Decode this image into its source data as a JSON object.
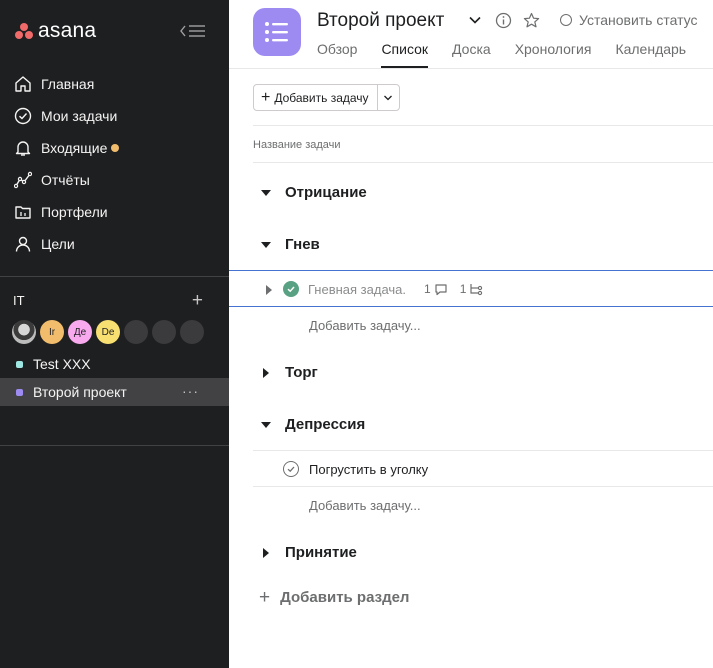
{
  "sidebar": {
    "logo_text": "asana",
    "nav": [
      {
        "label": "Главная",
        "icon": "home-icon"
      },
      {
        "label": "Мои задачи",
        "icon": "check-circle-icon"
      },
      {
        "label": "Входящие",
        "icon": "bell-icon"
      },
      {
        "label": "Отчёты",
        "icon": "reports-icon"
      },
      {
        "label": "Портфели",
        "icon": "folder-icon"
      },
      {
        "label": "Цели",
        "icon": "person-icon"
      }
    ],
    "team": {
      "name": "IT",
      "avatars": [
        {
          "initials": "",
          "color": "#3b3b3b"
        },
        {
          "initials": "Ir",
          "color": "#f1bd6c"
        },
        {
          "initials": "Де",
          "color": "#f9aaef"
        },
        {
          "initials": "De",
          "color": "#f8df72"
        },
        {
          "initials": "",
          "color": "#3b3b3d"
        },
        {
          "initials": "",
          "color": "#3b3b3d"
        },
        {
          "initials": "",
          "color": "#3b3b3d"
        }
      ]
    },
    "projects": [
      {
        "label": "Test XXX",
        "color": "#9ee7e3"
      },
      {
        "label": "Второй проект",
        "color": "#9d8bf2",
        "more": "···"
      }
    ]
  },
  "header": {
    "title": "Второй проект",
    "status_label": "Установить статус",
    "tabs": [
      "Обзор",
      "Список",
      "Доска",
      "Хронология",
      "Календарь"
    ],
    "active_tab": "Список"
  },
  "toolbar": {
    "add_task_label": "Добавить задачу"
  },
  "list": {
    "column_header": "Название задачи",
    "sections": [
      {
        "name": "Отрицание",
        "expanded": true
      },
      {
        "name": "Гнев",
        "expanded": true
      },
      {
        "name": "Торг",
        "expanded": false
      },
      {
        "name": "Депрессия",
        "expanded": true
      },
      {
        "name": "Принятие",
        "expanded": false
      }
    ],
    "task_gnev": {
      "name": "Гневная задача.",
      "comments": "1",
      "subtasks": "1",
      "completed": true
    },
    "task_depressia": {
      "name": "Погрустить в уголку",
      "completed": false
    },
    "add_task_in_section": "Добавить задачу...",
    "add_section_label": "Добавить раздел"
  },
  "colors": {
    "sidebar_bg": "#1e1f21",
    "accent_blue": "#4573d2",
    "complete_green": "#58a182",
    "project_purple": "#9d8bf2"
  }
}
